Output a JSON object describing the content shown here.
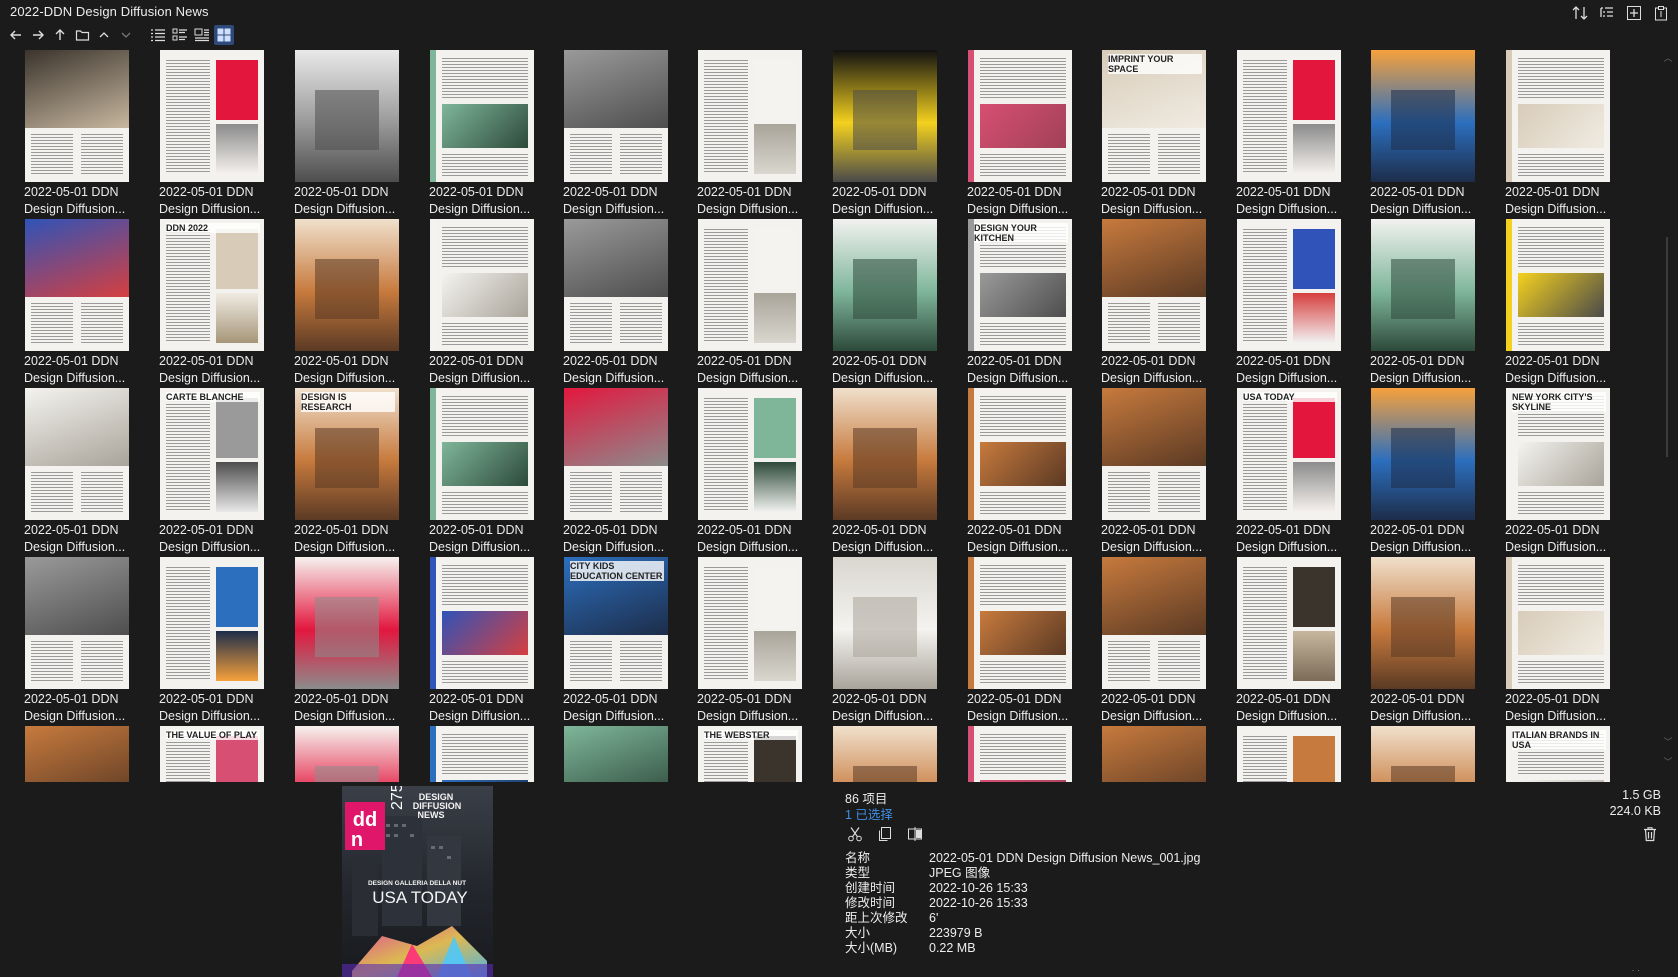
{
  "app": {
    "title": "2022-DDN Design Diffusion News"
  },
  "toolbar": {
    "back": "arrow-left-icon",
    "forward": "arrow-right-icon",
    "up": "arrow-up-icon",
    "folder": "folder-icon",
    "chevron_up": "chevron-up-icon",
    "chevron_down": "chevron-down-icon",
    "view_list": "view-list-icon",
    "view_details": "view-details-icon",
    "view_tiles": "view-tiles-icon",
    "view_thumbnails": "view-thumbnails-icon"
  },
  "window_tools": [
    "sort-icon",
    "outline-icon",
    "new-panel-icon",
    "clipboard-icon"
  ],
  "grid": {
    "caption_line1": "2022-05-01 DDN",
    "caption_line2": "Design Diffusion...",
    "thumbs": [
      {
        "style": "photo-interior-dark"
      },
      {
        "style": "news-red"
      },
      {
        "style": "text-photo-gray"
      },
      {
        "style": "news-green"
      },
      {
        "style": "text-door"
      },
      {
        "style": "news-chairs"
      },
      {
        "style": "yellow-ad"
      },
      {
        "style": "news-pink"
      },
      {
        "style": "fingerprint",
        "headline": "IMPRINT YOUR SPACE"
      },
      {
        "style": "news-text"
      },
      {
        "style": "archi-cover"
      },
      {
        "style": "text-wood"
      },
      {
        "style": "discover"
      },
      {
        "style": "text-vases",
        "headline": "DDN 2022"
      },
      {
        "style": "text-shelf"
      },
      {
        "style": "text-lamp"
      },
      {
        "style": "text-doors"
      },
      {
        "style": "text-landscape"
      },
      {
        "style": "pergola"
      },
      {
        "style": "kitchen",
        "headline": "DESIGN YOUR KITCHEN"
      },
      {
        "style": "text-bathroom"
      },
      {
        "style": "blue-chair"
      },
      {
        "style": "green-objects"
      },
      {
        "style": "yellow-phone"
      },
      {
        "style": "laptop"
      },
      {
        "style": "portrait",
        "headline": "CARTE BLANCHE"
      },
      {
        "style": "research",
        "headline": "DESIGN IS RESEARCH"
      },
      {
        "style": "green-vase"
      },
      {
        "style": "red-table"
      },
      {
        "style": "architecture-green"
      },
      {
        "style": "orange-room"
      },
      {
        "style": "restaurant"
      },
      {
        "style": "house-red"
      },
      {
        "style": "usa-today",
        "headline": "USA TODAY"
      },
      {
        "style": "sunset-city"
      },
      {
        "style": "skyline",
        "headline": "NEW YORK CITY'S SKYLINE"
      },
      {
        "style": "window-people"
      },
      {
        "style": "terrace"
      },
      {
        "style": "red-building"
      },
      {
        "style": "blue-hall"
      },
      {
        "style": "education",
        "headline": "CITY KIDS EDUCATION CENTER"
      },
      {
        "style": "white-space"
      },
      {
        "style": "white-clinic"
      },
      {
        "style": "lounge"
      },
      {
        "style": "living-sea"
      },
      {
        "style": "living-dark"
      },
      {
        "style": "dining"
      },
      {
        "style": "bedroom"
      },
      {
        "style": "row5-a"
      },
      {
        "style": "row5-b",
        "headline": "THE VALUE OF PLAY"
      },
      {
        "style": "row5-c"
      },
      {
        "style": "row5-d"
      },
      {
        "style": "row5-e"
      },
      {
        "style": "row5-f",
        "headline": "THE WEBSTER"
      },
      {
        "style": "row5-g"
      },
      {
        "style": "row5-h"
      },
      {
        "style": "row5-i"
      },
      {
        "style": "row5-j"
      },
      {
        "style": "row5-k"
      },
      {
        "style": "row5-l",
        "headline": "ITALIAN BRANDS IN USA"
      }
    ]
  },
  "status": {
    "count": "86 项目",
    "selected": "1 已选择",
    "total_size": "1.5 GB",
    "selected_size": "224.0 KB"
  },
  "actions": [
    "scissors-icon",
    "copy-icon",
    "compare-icon"
  ],
  "trash_icon": "trash-icon",
  "preview": {
    "logo": "ddn",
    "issue": "275",
    "masthead": "DESIGN DIFFUSION NEWS",
    "tagline": "DESIGN GALLERIA DELLA NUT",
    "headline": "USA TODAY"
  },
  "properties": [
    {
      "key": "名称",
      "value": "2022-05-01 DDN Design Diffusion News_001.jpg"
    },
    {
      "key": "类型",
      "value": "JPEG 图像"
    },
    {
      "key": "创建时间",
      "value": "2022-10-26  15:33"
    },
    {
      "key": "修改时间",
      "value": "2022-10-26  15:33"
    },
    {
      "key": "距上次修改",
      "value": "6'"
    },
    {
      "key": "大小",
      "value": "223979 B"
    },
    {
      "key": "大小(MB)",
      "value": "0.22 MB"
    }
  ],
  "colors": {
    "background": "#1b1b1b",
    "text": "#ececec",
    "accent_blue": "#3f8ee6",
    "active_view": "#2e4a7a"
  }
}
